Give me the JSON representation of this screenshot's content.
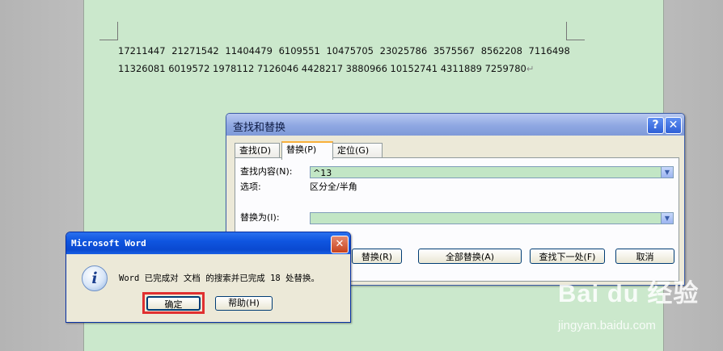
{
  "document": {
    "line1": "17211447 21271542 11404479 6109551 10475705 23025786 3575567 8562208 7116498",
    "line2": "11326081 6019572 1978112 7126046 4428217 3880966 10152741 4311889 7259780",
    "para_mark": "↵"
  },
  "find_replace": {
    "title": "查找和替换",
    "help_glyph": "?",
    "close_glyph": "✕",
    "tabs": [
      "查找(D)",
      "替换(P)",
      "定位(G)"
    ],
    "active_tab": "替换(P)",
    "find_label": "查找内容(N):",
    "find_value": "^13",
    "options_label": "选项:",
    "options_value": "区分全/半角",
    "replace_label": "替换为(I):",
    "replace_value": "",
    "buttons": {
      "replace": "替换(R)",
      "replace_all": "全部替换(A)",
      "find_next": "查找下一处(F)",
      "cancel": "取消"
    }
  },
  "message_box": {
    "title": "Microsoft Word",
    "message": "Word 已完成对 文档 的搜索并已完成 18 处替换。",
    "ok": "确定",
    "help": "帮助(H)",
    "icon": "info-icon",
    "close_glyph": "✕"
  },
  "watermark": {
    "logo": "Bai du 经验",
    "url": "jingyan.baidu.com"
  }
}
